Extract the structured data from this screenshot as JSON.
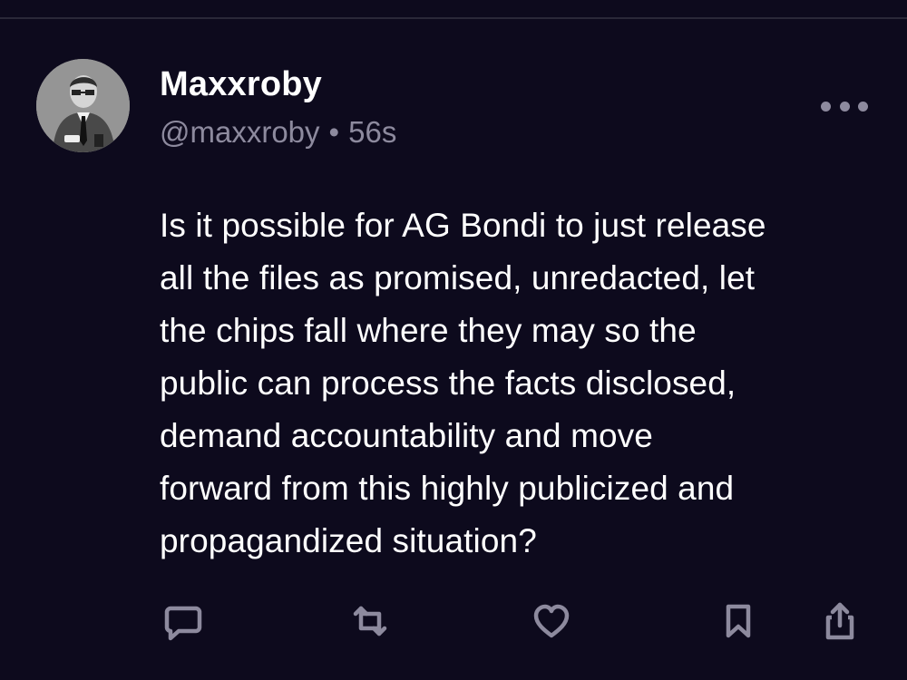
{
  "post": {
    "display_name": "Maxxroby",
    "handle": "@maxxroby",
    "separator": "•",
    "time": "56s",
    "text": "Is it possible for AG Bondi to just release\nall the files as promised, unredacted, let\nthe chips fall where they may so the\npublic can process the facts disclosed,\ndemand accountability and move\nforward from this highly publicized and\npropagandized situation?"
  },
  "icons": {
    "avatar": "profile-photo",
    "more": "more-horizontal-icon",
    "reply": "speech-bubble-icon",
    "repost": "repost-arrows-icon",
    "like": "heart-icon",
    "bookmark": "bookmark-icon",
    "share": "share-up-arrow-icon"
  },
  "colors": {
    "background": "#0d0a1d",
    "text_primary": "#ffffff",
    "text_secondary": "#8d8a9e",
    "icon": "#8d8a9e",
    "divider": "#2a2838"
  }
}
